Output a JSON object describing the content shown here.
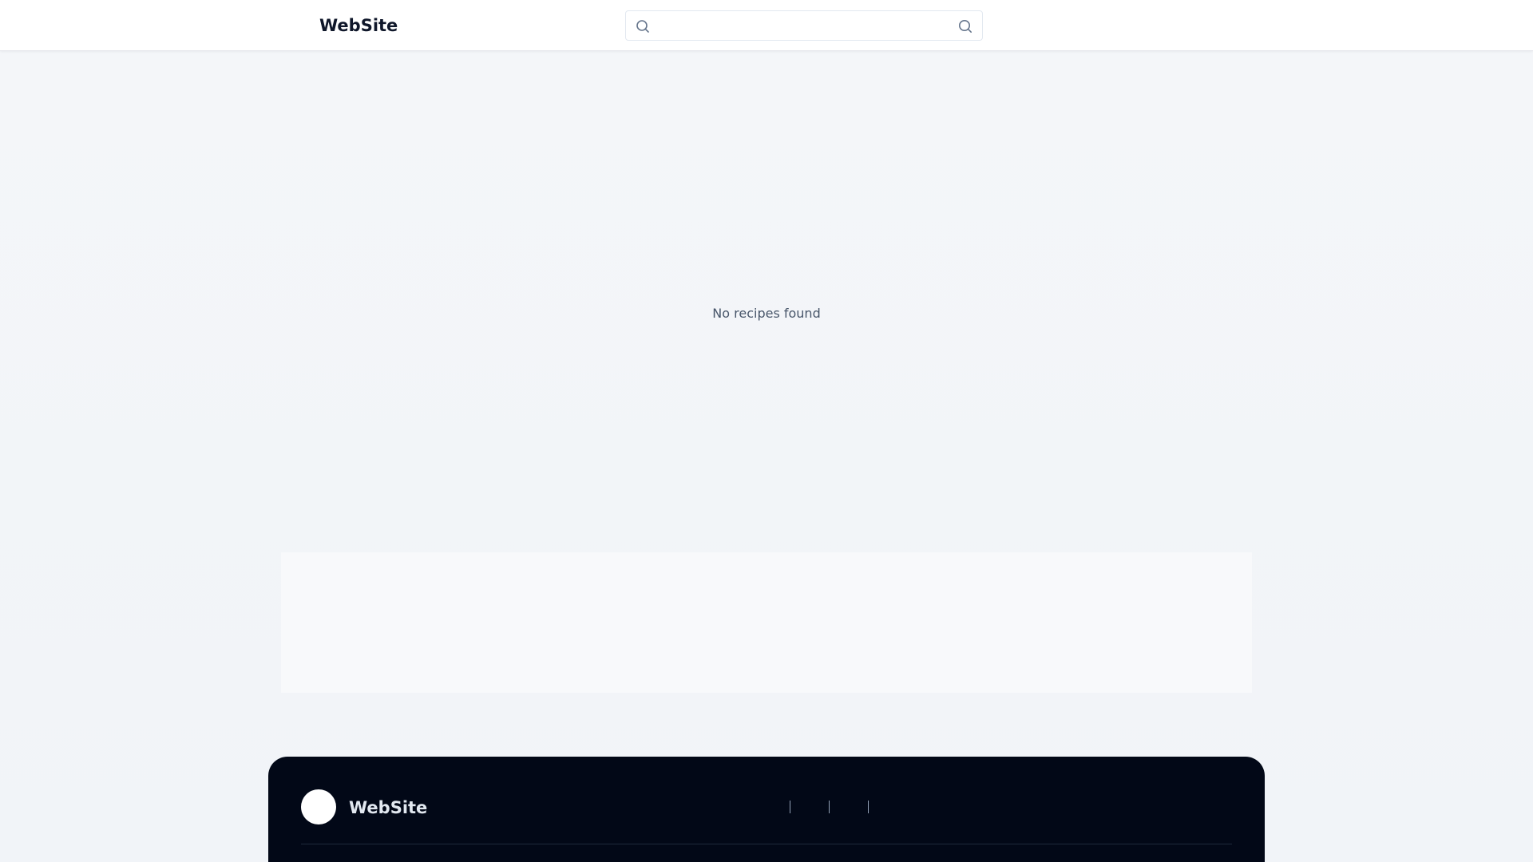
{
  "header": {
    "brand": "WebSite",
    "search": {
      "placeholder": "",
      "value": ""
    }
  },
  "main": {
    "empty_message": "No recipes found"
  },
  "footer": {
    "brand": "WebSite"
  },
  "icons": {
    "search_left": "search-icon",
    "search_button": "search-icon"
  },
  "colors": {
    "header_bg": "#ffffff",
    "page_bg": "#f2f5f9",
    "footer_bg": "#020817",
    "text_primary": "#0f172a",
    "text_muted": "#475569"
  }
}
